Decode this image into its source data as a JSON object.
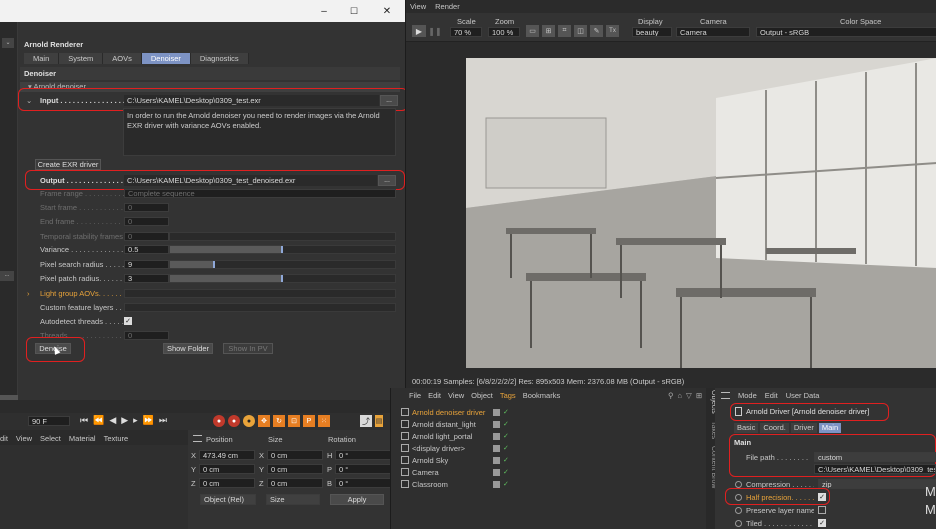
{
  "titlebar": {
    "minimize": "–",
    "maximize": "☐",
    "close": "✕"
  },
  "renderer": {
    "title": "Arnold Renderer",
    "tabs": [
      {
        "label": "Main",
        "active": false
      },
      {
        "label": "System",
        "active": false
      },
      {
        "label": "AOVs",
        "active": false
      },
      {
        "label": "Denoiser",
        "active": true
      },
      {
        "label": "Diagnostics",
        "active": false
      }
    ],
    "section": "Denoiser",
    "group": "Arnold denoiser",
    "input_label": "Input . . . . . . . . . . . . . . . .",
    "input_value": "C:\\Users\\KAMEL\\Desktop\\0309_test.exr",
    "browse": "...",
    "info": "In order to run the Arnold denoiser you need to render images via the Arnold EXR driver with variance AOVs enabled.",
    "create_exr": "Create EXR driver",
    "output_label": "Output . . . . . . . . . . . . . . .",
    "output_value": "C:\\Users\\KAMEL\\Desktop\\0309_test_denoised.exr",
    "frame_range_label": "Frame range . . . . . . . . . .",
    "frame_range_value": "Complete sequence",
    "start_frame_label": "Start frame . . . . . . . . . . .",
    "start_frame_value": "0",
    "end_frame_label": "End frame . . . . . . . . . . .",
    "end_frame_value": "0",
    "temporal_label": "Temporal stability frames",
    "temporal_value": "0",
    "variance_label": "Variance . . . . . . . . . . . . .",
    "variance_value": "0.5",
    "variance_fill": 0.5,
    "pixel_search_label": "Pixel search radius . . . . . .",
    "pixel_search_value": "9",
    "pixel_search_fill": 0.2,
    "pixel_patch_label": "Pixel patch radius. . . . . . .",
    "pixel_patch_value": "3",
    "pixel_patch_fill": 0.5,
    "light_group_label": "Light group AOVs. . . . . . . .",
    "custom_feature_label": "Custom feature layers . . . .",
    "autodetect_label": "Autodetect threads . . . . .",
    "threads_label": "Threads . . . . . . . . . . . . .",
    "threads_value": "0",
    "denoise_btn": "Denoise",
    "show_folder_btn": "Show Folder",
    "show_pv_btn": "Show In PV"
  },
  "viewer": {
    "menu": [
      "View",
      "Render"
    ],
    "scale_label": "Scale",
    "scale_value": "70 %",
    "zoom_label": "Zoom",
    "zoom_value": "100 %",
    "display_label": "Display",
    "display_value": "beauty",
    "camera_label": "Camera",
    "camera_value": "Camera",
    "colorspace_label": "Color Space",
    "colorspace_value": "Output - sRGB",
    "status": "00:00:19  Samples: [6/8/2/2/2/2]  Res: 895x503  Mem: 2376.08 MB  (Output - sRGB)"
  },
  "timeline": {
    "frame": "90 F"
  },
  "material_menu": [
    "dit",
    "View",
    "Select",
    "Material",
    "Texture"
  ],
  "coords": {
    "headers": [
      "Position",
      "Size",
      "Rotation"
    ],
    "rows": [
      {
        "a": "X",
        "pos": "473.49 cm",
        "b": "X",
        "size": "0 cm",
        "c": "H",
        "rot": "0 °"
      },
      {
        "a": "Y",
        "pos": "0 cm",
        "b": "Y",
        "size": "0 cm",
        "c": "P",
        "rot": "0 °"
      },
      {
        "a": "Z",
        "pos": "0 cm",
        "b": "Z",
        "size": "0 cm",
        "c": "B",
        "rot": "0 °"
      }
    ],
    "mode": "Object (Rel)",
    "size_mode": "Size",
    "apply": "Apply"
  },
  "objects": {
    "menu": [
      "File",
      "Edit",
      "View",
      "Object",
      "Tags",
      "Bookmarks"
    ],
    "items": [
      {
        "name": "Arnold denoiser driver",
        "color": "#e8a33a"
      },
      {
        "name": "Arnold distant_light",
        "color": "#c8c8c8"
      },
      {
        "name": "Arnold light_portal",
        "color": "#c8c8c8"
      },
      {
        "name": "<display driver>",
        "color": "#c8c8c8"
      },
      {
        "name": "Arnold Sky",
        "color": "#c8c8c8"
      },
      {
        "name": "Camera",
        "color": "#c8c8c8"
      },
      {
        "name": "Classroom",
        "color": "#c8c8c8"
      }
    ],
    "side_tabs": [
      "Objects",
      "Takes",
      "Content Brow"
    ]
  },
  "attributes": {
    "menu": [
      "Mode",
      "Edit",
      "User Data"
    ],
    "title": "Arnold Driver [Arnold denoiser driver]",
    "tabs": [
      {
        "label": "Basic",
        "active": false
      },
      {
        "label": "Coord.",
        "active": false
      },
      {
        "label": "Driver",
        "active": false
      },
      {
        "label": "Main",
        "active": true
      }
    ],
    "section": "Main",
    "file_path_label": "File path . . . . . . . .",
    "file_path_mode": "custom",
    "file_path_value": "C:\\Users\\KAMEL\\Desktop\\0309_test",
    "compression_label": "Compression . . . . . .",
    "compression_value": "zip",
    "half_precision_label": "Half precision. . . . . .",
    "preserve_label": "Preserve layer name",
    "tiled_label": "Tiled . . . . . . . . . . . .",
    "edge_text": "M"
  }
}
